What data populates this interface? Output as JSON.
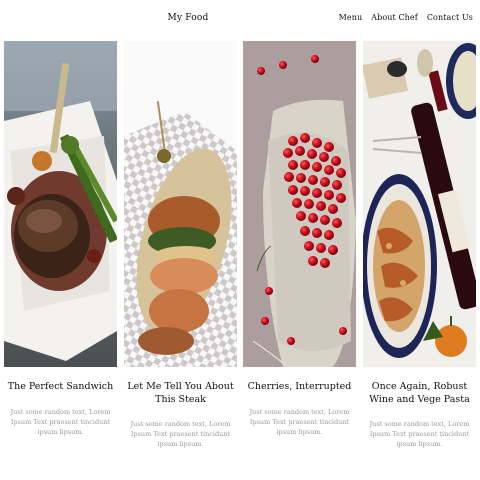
{
  "header": {
    "brand": "My Food",
    "nav": [
      "Menu",
      "About Chef",
      "Contact Us"
    ]
  },
  "cards": [
    {
      "title": "The Perfect Sandwich",
      "text": "Just some random text, Lorem Ipsum Text praesent tincidunt ipsum lipsum.",
      "image": "steak-with-asparagus-photo"
    },
    {
      "title": "Let Me Tell You About This Steak",
      "text": "Just some random text, Lorem Ipsum Text praesent tincidunt ipsum lipsum.",
      "image": "sandwich-on-checkered-paper-photo"
    },
    {
      "title": "Cherries, Interrupted",
      "text": "Just some random text, Lorem Ipsum Text praesent tincidunt ipsum lipsum.",
      "image": "cherries-bowl-photo"
    },
    {
      "title": "Once Again, Robust Wine and Vege Pasta",
      "text": "Just some random text, Lorem Ipsum Text praesent tincidunt ipsum lipsum.",
      "image": "pasta-and-wine-photo"
    }
  ]
}
